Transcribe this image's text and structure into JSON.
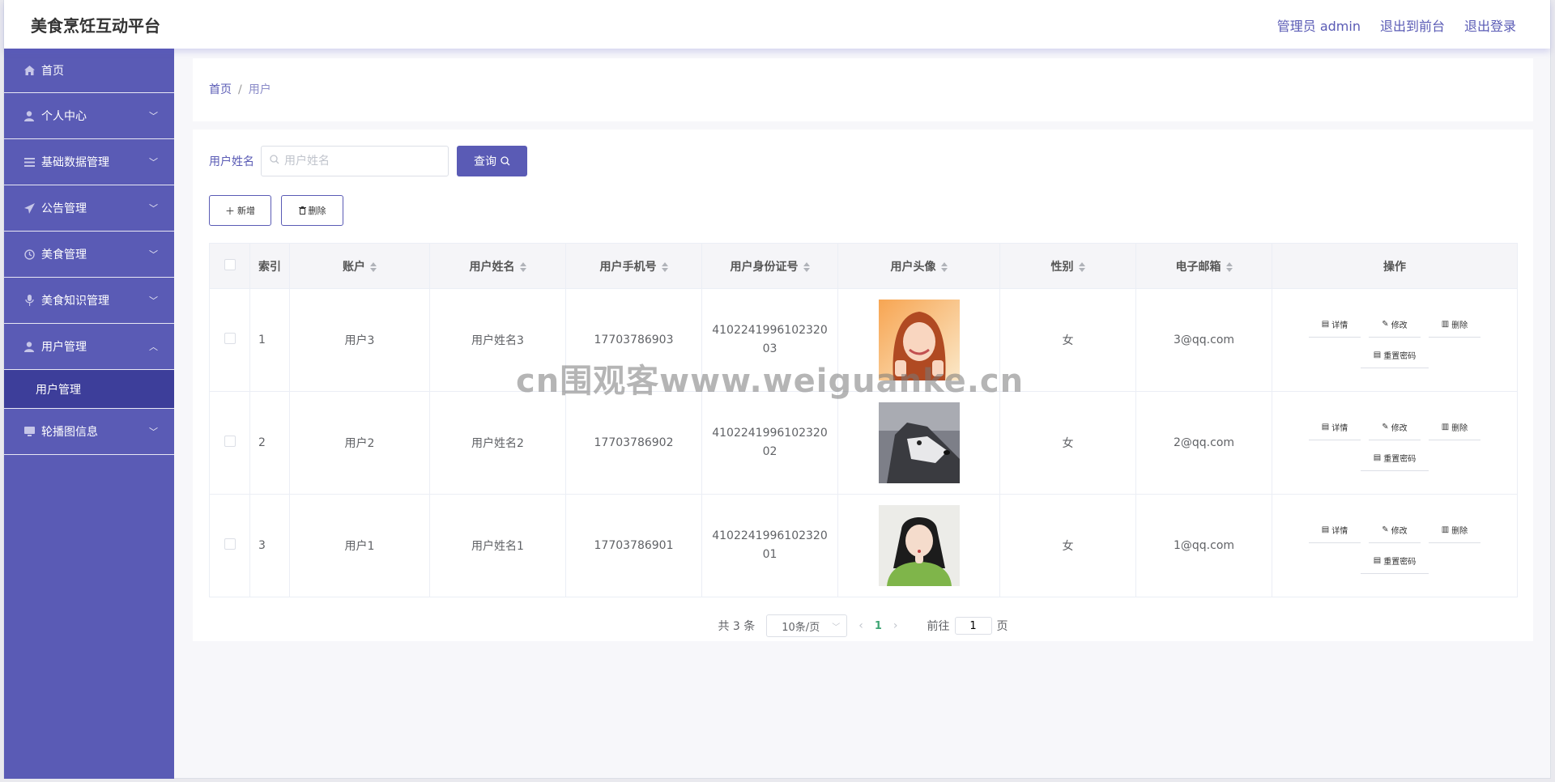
{
  "header": {
    "title": "美食烹饪互动平台",
    "links": [
      "管理员 admin",
      "退出到前台",
      "退出登录"
    ]
  },
  "sidebar": {
    "items": [
      {
        "label": "首页",
        "icon": "home-icon"
      },
      {
        "label": "个人中心",
        "icon": "user-icon"
      },
      {
        "label": "基础数据管理",
        "icon": "list-icon"
      },
      {
        "label": "公告管理",
        "icon": "send-icon"
      },
      {
        "label": "美食管理",
        "icon": "clock-icon"
      },
      {
        "label": "美食知识管理",
        "icon": "microphone-icon"
      },
      {
        "label": "用户管理",
        "icon": "user-icon"
      },
      {
        "label": "轮播图信息",
        "icon": "monitor-icon"
      }
    ],
    "subitem": "用户管理"
  },
  "breadcrumb": {
    "home": "首页",
    "sep": "/",
    "current": "用户"
  },
  "search": {
    "label": "用户姓名",
    "placeholder": "用户姓名",
    "button": "查询"
  },
  "actions": {
    "add": "新增",
    "delete": "删除"
  },
  "table": {
    "headers": [
      "索引",
      "账户",
      "用户姓名",
      "用户手机号",
      "用户身份证号",
      "用户头像",
      "性别",
      "电子邮箱",
      "操作"
    ],
    "rows": [
      {
        "index": "1",
        "account": "用户3",
        "name": "用户姓名3",
        "phone": "17703786903",
        "idcard": "410224199610232003",
        "gender": "女",
        "email": "3@qq.com",
        "avatar": "avatar-woman-smiling"
      },
      {
        "index": "2",
        "account": "用户2",
        "name": "用户姓名2",
        "phone": "17703786902",
        "idcard": "410224199610232002",
        "gender": "女",
        "email": "2@qq.com",
        "avatar": "avatar-husky-dog"
      },
      {
        "index": "3",
        "account": "用户1",
        "name": "用户姓名1",
        "phone": "17703786901",
        "idcard": "410224199610232001",
        "gender": "女",
        "email": "1@qq.com",
        "avatar": "avatar-girl-green-sweater"
      }
    ],
    "ops": {
      "detail": "详情",
      "edit": "修改",
      "delete": "删除",
      "reset": "重置密码"
    }
  },
  "pagination": {
    "total": "共 3 条",
    "page_size": "10条/页",
    "current": "1",
    "goto": "前往",
    "goto_value": "1",
    "page_unit": "页"
  },
  "watermark": "cn围观客www.weiguanke.cn",
  "colors": {
    "accent": "#5a5bb5",
    "sidebar_active": "#3d3e9a",
    "page_active": "#3fa574"
  }
}
